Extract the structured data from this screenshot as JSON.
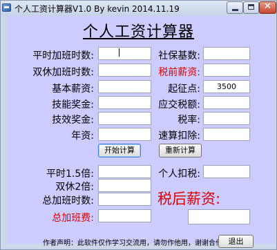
{
  "window": {
    "title": "个人工资计算器V1.0 By kevin 2014.11.19"
  },
  "heading": "个人工资计算器",
  "labels": {
    "weekday_ot_hours": "平时加班时数:",
    "weekend_ot_hours": "双休加班时数:",
    "base_salary": "基本薪资:",
    "skill_bonus": "技能奖金:",
    "performance_bonus": "技效奖金:",
    "seniority_pay": "年资:",
    "social_security_base": "社保基数:",
    "pre_tax_salary": "税前薪资:",
    "threshold": "起征点:",
    "taxable_amount": "应交税额:",
    "tax_rate": "税率:",
    "quick_deduction": "速算扣除:",
    "weekday_1_5x": "平时1.5倍:",
    "weekend_2x": "双休2倍:",
    "total_ot_hours": "总加班时数:",
    "total_ot_pay": "总加班费:",
    "personal_tax": "个人扣税:",
    "after_tax_salary": "税后薪资:"
  },
  "fields": {
    "threshold": "3500"
  },
  "buttons": {
    "calculate": "开始计算",
    "recalculate": "重新计算",
    "exit": "退出"
  },
  "note": "作者声明：此软件仅作学习交流用，请勿作他用，谢谢合作！！"
}
